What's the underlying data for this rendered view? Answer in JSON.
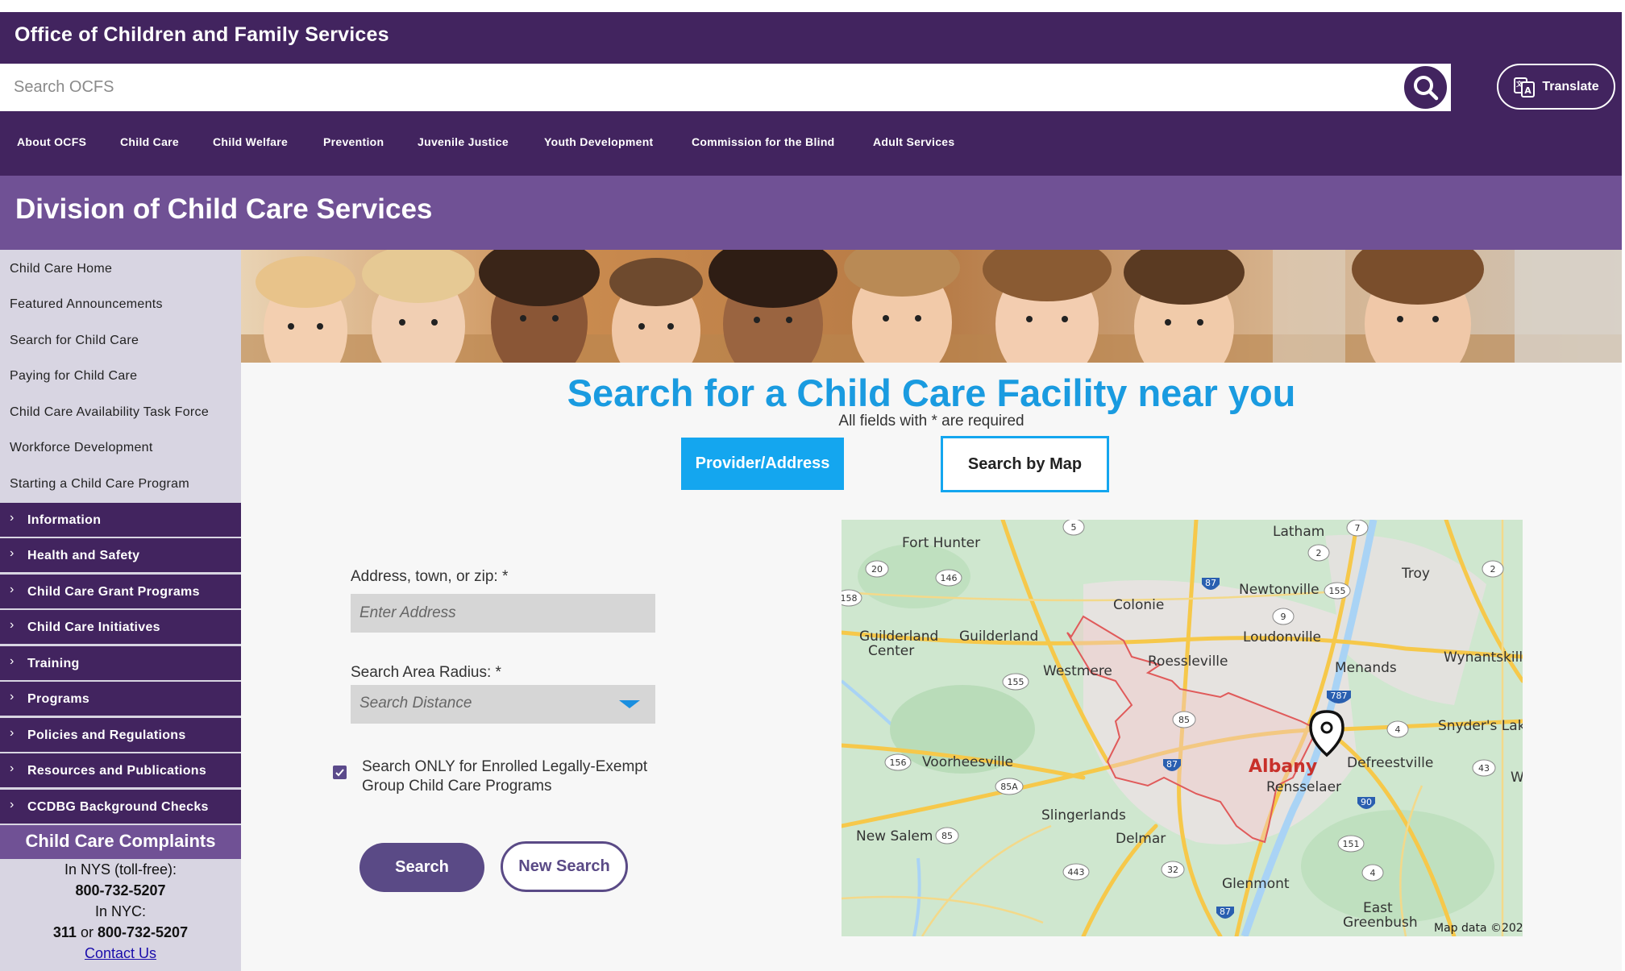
{
  "header": {
    "brand": "Office of Children and Family Services",
    "search_placeholder": "Search OCFS",
    "translate_label": "Translate"
  },
  "nav": {
    "items": [
      "About OCFS",
      "Child Care",
      "Child Welfare",
      "Prevention",
      "Juvenile Justice",
      "Youth Development",
      "Commission for the Blind",
      "Adult Services"
    ]
  },
  "division": {
    "title": "Division of Child Care Services"
  },
  "sidebar": {
    "links": [
      "Child Care Home",
      "Featured Announcements",
      "Search for Child Care",
      "Paying for Child Care",
      "Child Care Availability Task Force",
      "Workforce Development",
      "Starting a Child Care Program"
    ],
    "accordion": [
      "Information",
      "Health and Safety",
      "Child Care Grant Programs",
      "Child Care Initiatives",
      "Training",
      "Programs",
      "Policies and Regulations",
      "Resources and Publications",
      "CCDBG Background Checks"
    ],
    "complaints": {
      "title": "Child Care Complaints",
      "nys_label": "In NYS (toll-free):",
      "nys_phone": "800-732-5207",
      "nyc_label": "In NYC:",
      "nyc_311": "311",
      "nyc_or": "or",
      "nyc_phone": "800-732-5207",
      "contact": "Contact Us"
    }
  },
  "main": {
    "title": "Search for a Child Care Facility near you",
    "subtitle": "All fields with * are required",
    "tab_provider": "Provider/Address",
    "tab_map": "Search by Map",
    "address_label": "Address, town, or zip: *",
    "address_placeholder": "Enter Address",
    "radius_label": "Search Area Radius: *",
    "radius_placeholder": "Search Distance",
    "checkbox_label": "Search ONLY for Enrolled Legally-Exempt Group Child Care Programs",
    "checkbox_checked": true,
    "search_button": "Search",
    "new_search_button": "New Search"
  },
  "map": {
    "places": {
      "fort_hunter": "Fort Hunter",
      "latham": "Latham",
      "troy": "Troy",
      "colonie": "Colonie",
      "newtonville": "Newtonville",
      "loudonville": "Loudonville",
      "guilderland_center": "Guilderland\nCenter",
      "guilderland": "Guilderland",
      "roessleville": "Roessleville",
      "westmere": "Westmere",
      "menands": "Menands",
      "wynantskill": "Wynantskill",
      "snyders_lake": "Snyder's Lak",
      "voorheesville": "Voorheesville",
      "albany": "Albany",
      "defreestville": "Defreestville",
      "rensselaer": "Rensselaer",
      "slingerlands": "Slingerlands",
      "new_salem": "New Salem",
      "delmar": "Delmar",
      "glenmont": "Glenmont",
      "east_greenbush": "East\nGreenbush",
      "w_edge": "W"
    },
    "shields": [
      "5",
      "7",
      "2",
      "20",
      "146",
      "87",
      "155",
      "2",
      "158",
      "9",
      "155",
      "787",
      "85",
      "4",
      "156",
      "87",
      "85A",
      "43",
      "90",
      "85",
      "443",
      "32",
      "151",
      "4",
      "87"
    ],
    "attribution": "Map data ©202",
    "colors": {
      "land": "#cfe7cf",
      "water": "#a9d3f5",
      "highway": "#f6c84a",
      "boundary": "#e05a5a",
      "albany_label": "#c8302a"
    }
  },
  "colors": {
    "header": "#42245f",
    "division": "#705195",
    "accent_blue": "#14a6ef",
    "title_blue": "#1a9be0",
    "button_purple": "#5a4a86"
  }
}
